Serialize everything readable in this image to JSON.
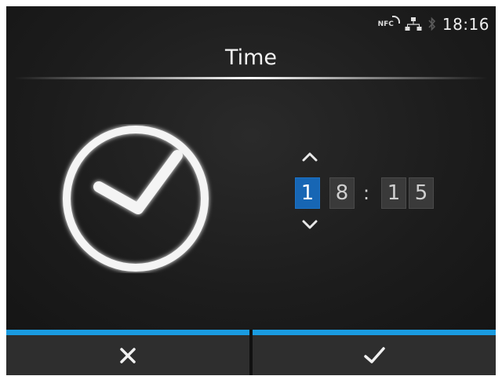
{
  "status_bar": {
    "nfc_label": "NFC",
    "icons": [
      "nfc-icon",
      "network-icon",
      "bluetooth-icon"
    ],
    "time": "18:16"
  },
  "title": "Time",
  "time_editor": {
    "digits": [
      "1",
      "8",
      "1",
      "5"
    ],
    "separator": ":",
    "selected_digit_index": 0
  },
  "buttons": {
    "cancel_icon": "close-icon",
    "ok_icon": "check-icon"
  },
  "colors": {
    "accent": "#1a9be0",
    "selected_digit": "#1766b4",
    "background": "#1f1f1f"
  }
}
